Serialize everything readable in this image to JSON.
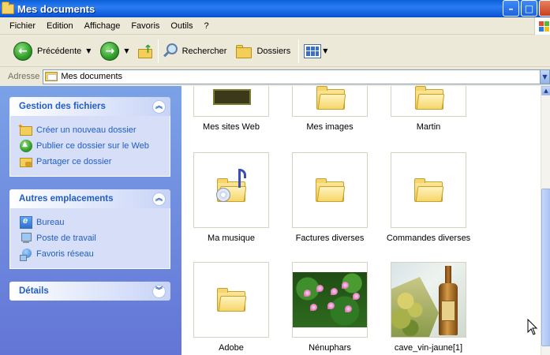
{
  "window": {
    "title": "Mes documents"
  },
  "menu": [
    "Fichier",
    "Edition",
    "Affichage",
    "Favoris",
    "Outils",
    "?"
  ],
  "toolbar": {
    "back_label": "Précédente",
    "search_label": "Rechercher",
    "folders_label": "Dossiers"
  },
  "address": {
    "label": "Adresse",
    "value": "Mes documents"
  },
  "tasks": {
    "file_tasks": {
      "title": "Gestion des fichiers",
      "items": [
        "Créer un nouveau dossier",
        "Publier ce dossier sur le Web",
        "Partager ce dossier"
      ]
    },
    "other_places": {
      "title": "Autres emplacements",
      "items": [
        "Bureau",
        "Poste de travail",
        "Favoris réseau"
      ]
    },
    "details": {
      "title": "Détails"
    }
  },
  "files": [
    {
      "name": "Mes sites Web",
      "icon": "web-folder-icon"
    },
    {
      "name": "Mes images",
      "icon": "folder-icon"
    },
    {
      "name": "Martin",
      "icon": "folder-icon"
    },
    {
      "name": "Ma musique",
      "icon": "music-folder-icon"
    },
    {
      "name": "Factures diverses",
      "icon": "folder-icon"
    },
    {
      "name": "Commandes diverses",
      "icon": "folder-icon"
    },
    {
      "name": "Adobe",
      "icon": "folder-icon"
    },
    {
      "name": "Nénuphars",
      "icon": "image-thumbnail"
    },
    {
      "name": "cave_vin-jaune[1]",
      "icon": "image-thumbnail"
    }
  ]
}
